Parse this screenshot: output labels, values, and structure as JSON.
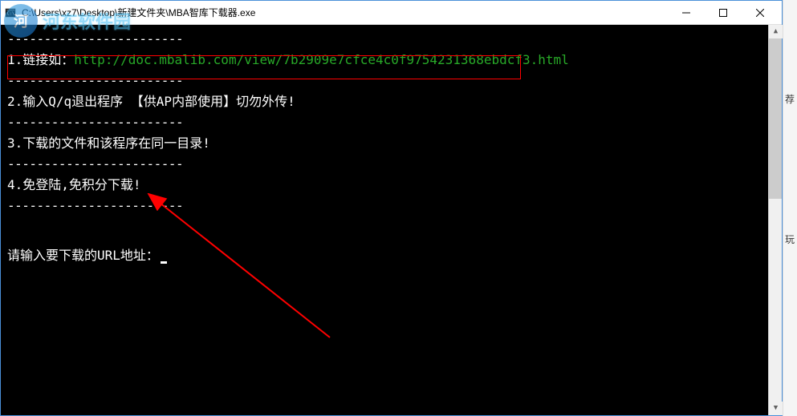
{
  "watermark": {
    "icon_text": "河",
    "text": "河东软件园"
  },
  "window": {
    "title": "C:\\Users\\xz7\\Desktop\\新建文件夹\\MBA智库下载器.exe"
  },
  "console": {
    "dash_line": "------------------------",
    "line1_prefix": "1.链接如：",
    "line1_url": "http://doc.mbalib.com/view/7b2909e7cfce4c0f9754231368ebdcf3.html",
    "line2": "2.输入Q/q退出程序 【供AP内部使用】切勿外传!",
    "line3": "3.下载的文件和该程序在同一目录!",
    "line4": "4.免登陆,免积分下载!",
    "prompt": "请输入要下载的URL地址："
  },
  "side_chars": {
    "c1": "荐",
    "c2": "玩"
  }
}
